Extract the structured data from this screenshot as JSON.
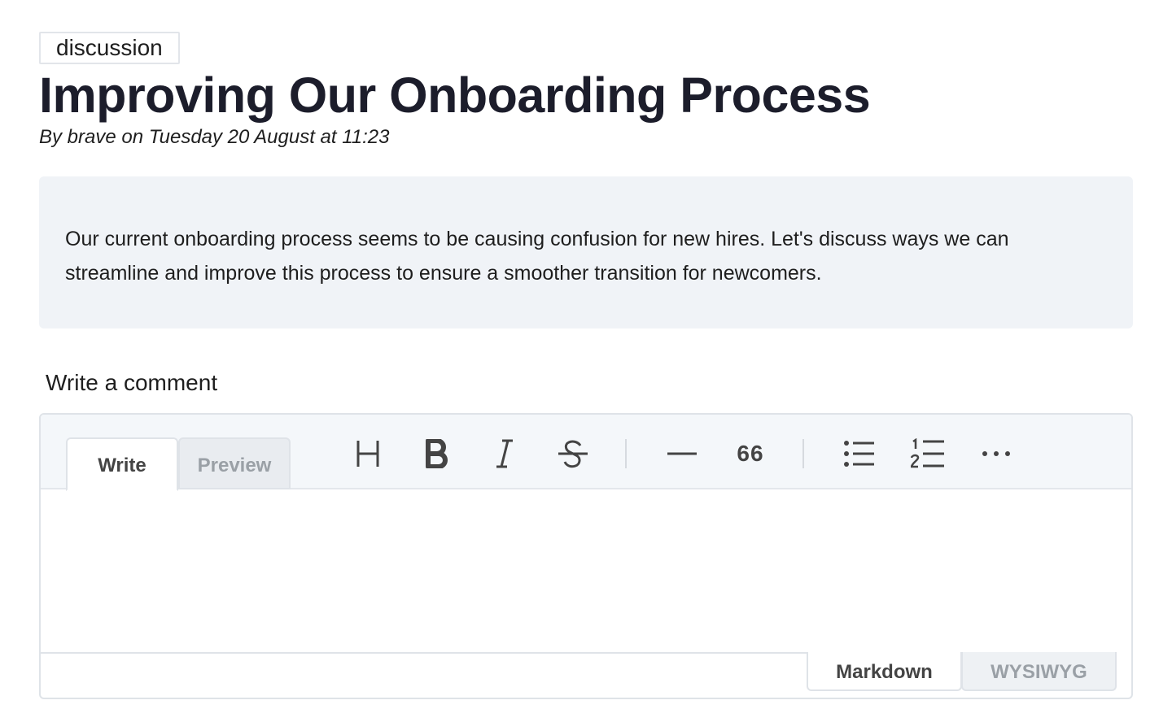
{
  "post": {
    "tag": "discussion",
    "title": "Improving Our Onboarding Process",
    "byline": "By brave on Tuesday 20 August at 11:23",
    "body": "Our current onboarding process seems to be causing confusion for new hires. Let's discuss ways we can streamline and improve this process to ensure a smoother transition for newcomers."
  },
  "comment": {
    "label": "Write a comment",
    "tabs": {
      "write": "Write",
      "preview": "Preview"
    },
    "toolbar": [
      "heading-icon",
      "bold-icon",
      "italic-icon",
      "strikethrough-icon",
      "horizontal-rule-icon",
      "quote-icon",
      "bullet-list-icon",
      "ordered-list-icon",
      "more-icon"
    ],
    "quote_glyph": "66",
    "mode": {
      "markdown": "Markdown",
      "wysiwyg": "WYSIWYG"
    },
    "value": ""
  }
}
